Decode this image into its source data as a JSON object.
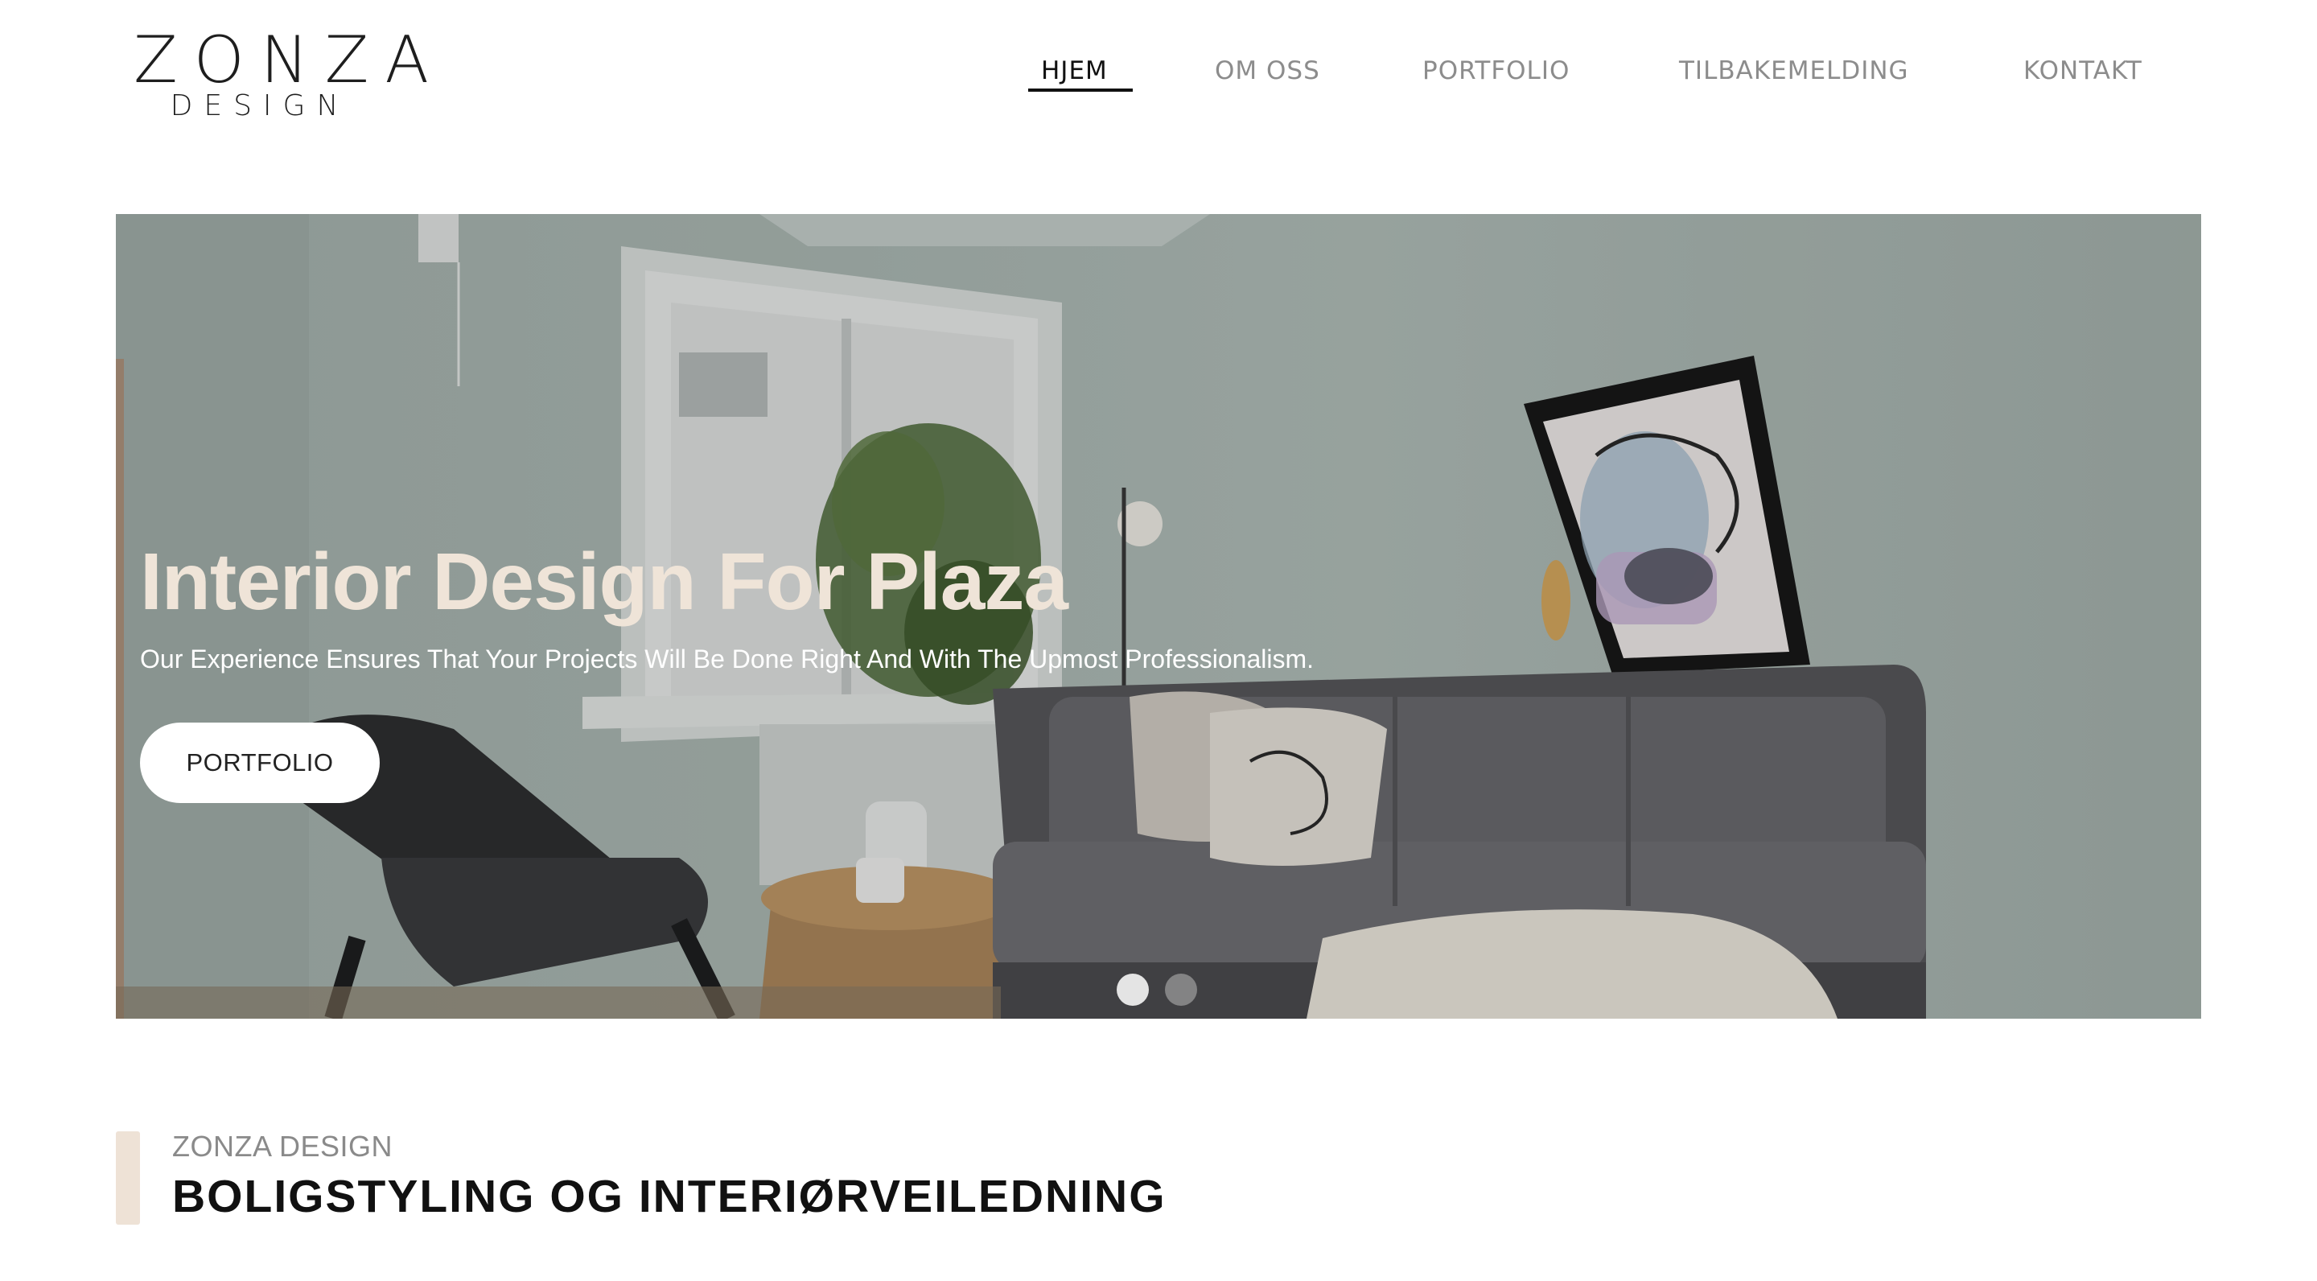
{
  "logo": {
    "name": "ZONZA",
    "sub": "DESIGN"
  },
  "nav": {
    "items": [
      {
        "label": "HJEM",
        "active": true
      },
      {
        "label": "OM OSS",
        "active": false
      },
      {
        "label": "PORTFOLIO",
        "active": false
      },
      {
        "label": "TILBAKEMELDING",
        "active": false
      },
      {
        "label": "KONTAKT",
        "active": false
      }
    ]
  },
  "hero": {
    "title": "Interior Design For Plaza",
    "subtitle": "Our Experience Ensures That Your Projects Will Be Done Right And With The Upmost Professionalism.",
    "button_label": "PORTFOLIO",
    "slides": {
      "count": 2,
      "active_index": 0
    }
  },
  "section": {
    "kicker": "ZONZA DESIGN",
    "title": "BOLIGSTYLING OG INTERIØRVEILEDNING"
  },
  "colors": {
    "accent_beige": "#eee2d6",
    "hero_title": "#efe4d8",
    "nav_active": "#111111",
    "nav_inactive": "#8c8c8c",
    "wall_sage": "#a9b6b1"
  }
}
